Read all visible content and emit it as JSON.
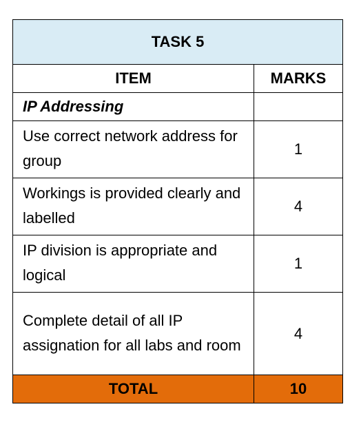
{
  "table": {
    "title": "TASK 5",
    "headers": {
      "item": "ITEM",
      "marks": "MARKS"
    },
    "section": "IP Addressing",
    "rows": [
      {
        "item": "Use correct network address for group",
        "marks": "1"
      },
      {
        "item": "Workings is provided clearly and labelled",
        "marks": "4"
      },
      {
        "item": "IP division is appropriate and logical",
        "marks": "1"
      },
      {
        "item": "Complete detail of all IP assignation for all labs and room",
        "marks": "4"
      }
    ],
    "total": {
      "label": "TOTAL",
      "value": "10"
    }
  },
  "colors": {
    "title_bg": "#d9ecf5",
    "total_bg": "#e36c0a",
    "border": "#000000"
  }
}
